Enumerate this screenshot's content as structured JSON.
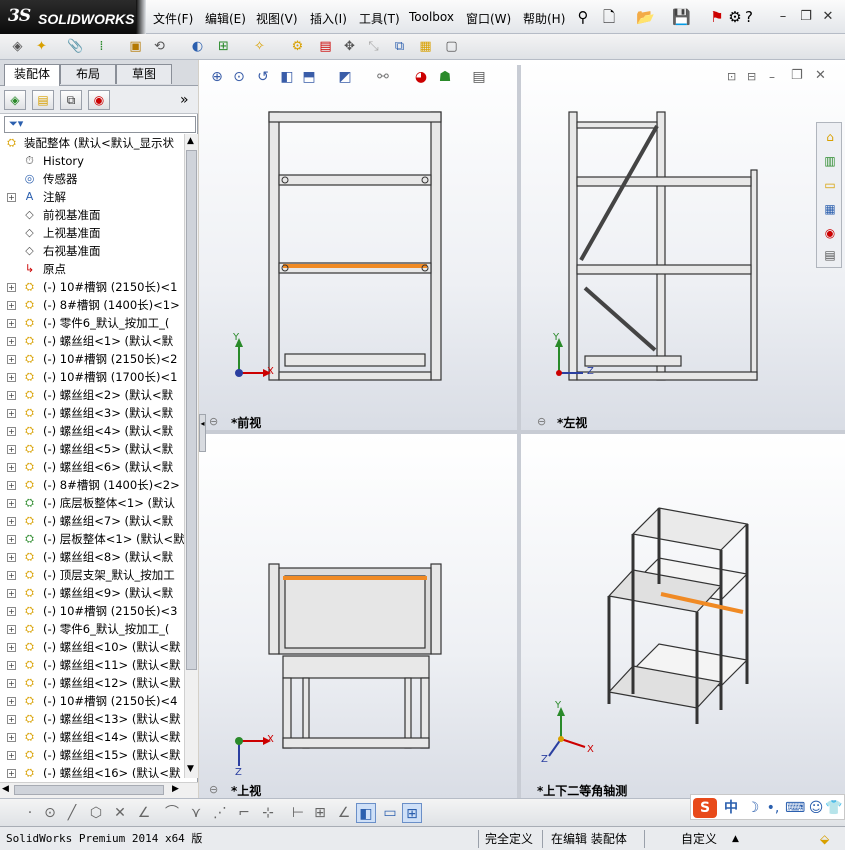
{
  "app": {
    "logo_ds": "3S",
    "logo_name": "SOLIDWORKS",
    "menus": [
      "文件(F)",
      "编辑(E)",
      "视图(V)",
      "插入(I)",
      "工具(T)",
      "Toolbox",
      "窗口(W)",
      "帮助(H)"
    ]
  },
  "left_panel": {
    "tabs": [
      "装配体",
      "布局",
      "草图"
    ],
    "active_tab": 0,
    "root": "装配整体  (默认<默认_显示状",
    "tree_items": [
      {
        "label": "History",
        "icon": "history-icon",
        "expandable": false
      },
      {
        "label": "传感器",
        "icon": "sensor-icon",
        "expandable": false
      },
      {
        "label": "注解",
        "icon": "annotation-icon",
        "expandable": true
      },
      {
        "label": "前视基准面",
        "icon": "plane-icon",
        "expandable": false
      },
      {
        "label": "上视基准面",
        "icon": "plane-icon",
        "expandable": false
      },
      {
        "label": "右视基准面",
        "icon": "plane-icon",
        "expandable": false
      },
      {
        "label": "原点",
        "icon": "origin-icon",
        "expandable": false
      },
      {
        "label": "(-) 10#槽钢 (2150长)<1",
        "icon": "part-icon",
        "expandable": true
      },
      {
        "label": "(-) 8#槽钢 (1400长)<1>",
        "icon": "part-icon",
        "expandable": true
      },
      {
        "label": "(-) 零件6_默认_按加工_(",
        "icon": "part-icon",
        "expandable": true
      },
      {
        "label": "(-) 螺丝组<1> (默认<默",
        "icon": "part-icon",
        "expandable": true
      },
      {
        "label": "(-) 10#槽钢 (2150长)<2",
        "icon": "part-icon",
        "expandable": true
      },
      {
        "label": "(-) 10#槽钢 (1700长)<1",
        "icon": "part-icon",
        "expandable": true
      },
      {
        "label": "(-) 螺丝组<2> (默认<默",
        "icon": "part-icon",
        "expandable": true
      },
      {
        "label": "(-) 螺丝组<3> (默认<默",
        "icon": "part-icon",
        "expandable": true
      },
      {
        "label": "(-) 螺丝组<4> (默认<默",
        "icon": "part-icon",
        "expandable": true
      },
      {
        "label": "(-) 螺丝组<5> (默认<默",
        "icon": "part-icon",
        "expandable": true
      },
      {
        "label": "(-) 螺丝组<6> (默认<默",
        "icon": "part-icon",
        "expandable": true
      },
      {
        "label": "(-) 8#槽钢 (1400长)<2>",
        "icon": "part-icon",
        "expandable": true
      },
      {
        "label": "(-) 底层板整体<1> (默认",
        "icon": "subassembly-icon",
        "expandable": true
      },
      {
        "label": "(-) 螺丝组<7> (默认<默",
        "icon": "part-icon",
        "expandable": true
      },
      {
        "label": "(-) 层板整体<1> (默认<默",
        "icon": "subassembly-icon",
        "expandable": true
      },
      {
        "label": "(-) 螺丝组<8> (默认<默",
        "icon": "part-icon",
        "expandable": true
      },
      {
        "label": "(-) 顶层支架_默认_按加工",
        "icon": "part-icon",
        "expandable": true
      },
      {
        "label": "(-) 螺丝组<9> (默认<默",
        "icon": "part-icon",
        "expandable": true
      },
      {
        "label": "(-) 10#槽钢 (2150长)<3",
        "icon": "part-icon",
        "expandable": true
      },
      {
        "label": "(-) 零件6_默认_按加工_(",
        "icon": "part-icon",
        "expandable": true
      },
      {
        "label": "(-) 螺丝组<10> (默认<默",
        "icon": "part-icon",
        "expandable": true
      },
      {
        "label": "(-) 螺丝组<11> (默认<默",
        "icon": "part-icon",
        "expandable": true
      },
      {
        "label": "(-) 螺丝组<12> (默认<默",
        "icon": "part-icon",
        "expandable": true
      },
      {
        "label": "(-) 10#槽钢 (2150长)<4",
        "icon": "part-icon",
        "expandable": true
      },
      {
        "label": "(-) 螺丝组<13> (默认<默",
        "icon": "part-icon",
        "expandable": true
      },
      {
        "label": "(-) 螺丝组<14> (默认<默",
        "icon": "part-icon",
        "expandable": true
      },
      {
        "label": "(-) 螺丝组<15> (默认<默",
        "icon": "part-icon",
        "expandable": true
      },
      {
        "label": "(-) 螺丝组<16> (默认<默",
        "icon": "part-icon",
        "expandable": true
      }
    ]
  },
  "viewports": {
    "front": "*前视",
    "left": "*左视",
    "top": "*上视",
    "iso": "*上下二等角轴测",
    "axis_x": "X",
    "axis_y": "Y",
    "axis_z": "Z"
  },
  "status": {
    "product": "SolidWorks Premium 2014 x64 版",
    "defined": "完全定义",
    "editing": "在编辑 装配体",
    "units": "自定义",
    "units_arrow": "▲"
  },
  "ime": {
    "brand": "S",
    "mode": "中"
  },
  "colors": {
    "accent_orange": "#f08a24",
    "icon_yellow": "#e6b800"
  }
}
